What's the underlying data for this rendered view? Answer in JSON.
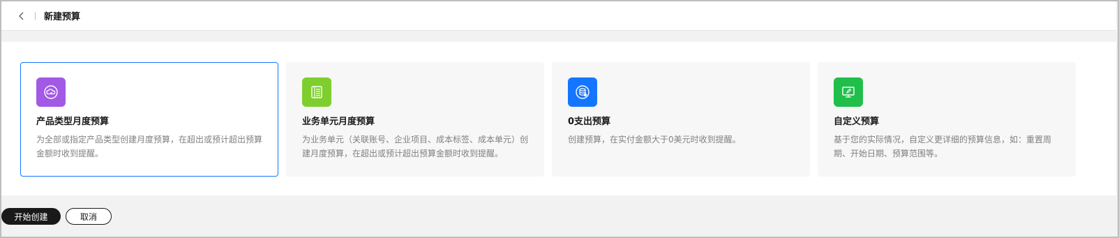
{
  "header": {
    "title": "新建预算"
  },
  "cards": [
    {
      "title": "产品类型月度预算",
      "description": "为全部或指定产品类型创建月度预算，在超出或预计超出预算金额时收到提醒。",
      "icon": "cloud-budget-icon",
      "icon_color": "#a259e6",
      "selected": true
    },
    {
      "title": "业务单元月度预算",
      "description": "为业务单元（关联账号、企业项目、成本标签、成本单元）创建月度预算，在超出或预计超出预算金额时收到提醒。",
      "icon": "ledger-icon",
      "icon_color": "#7ecf2e",
      "selected": false
    },
    {
      "title": "0支出预算",
      "description": "创建预算，在实付金额大于0美元时收到提醒。",
      "icon": "database-icon",
      "icon_color": "#1476ff",
      "selected": false
    },
    {
      "title": "自定义预算",
      "description": "基于您的实际情况，自定义更详细的预算信息，如：重置周期、开始日期、预算范围等。",
      "icon": "edit-monitor-icon",
      "icon_color": "#1fbf4a",
      "selected": false
    }
  ],
  "footer": {
    "start_label": "开始创建",
    "cancel_label": "取消"
  }
}
